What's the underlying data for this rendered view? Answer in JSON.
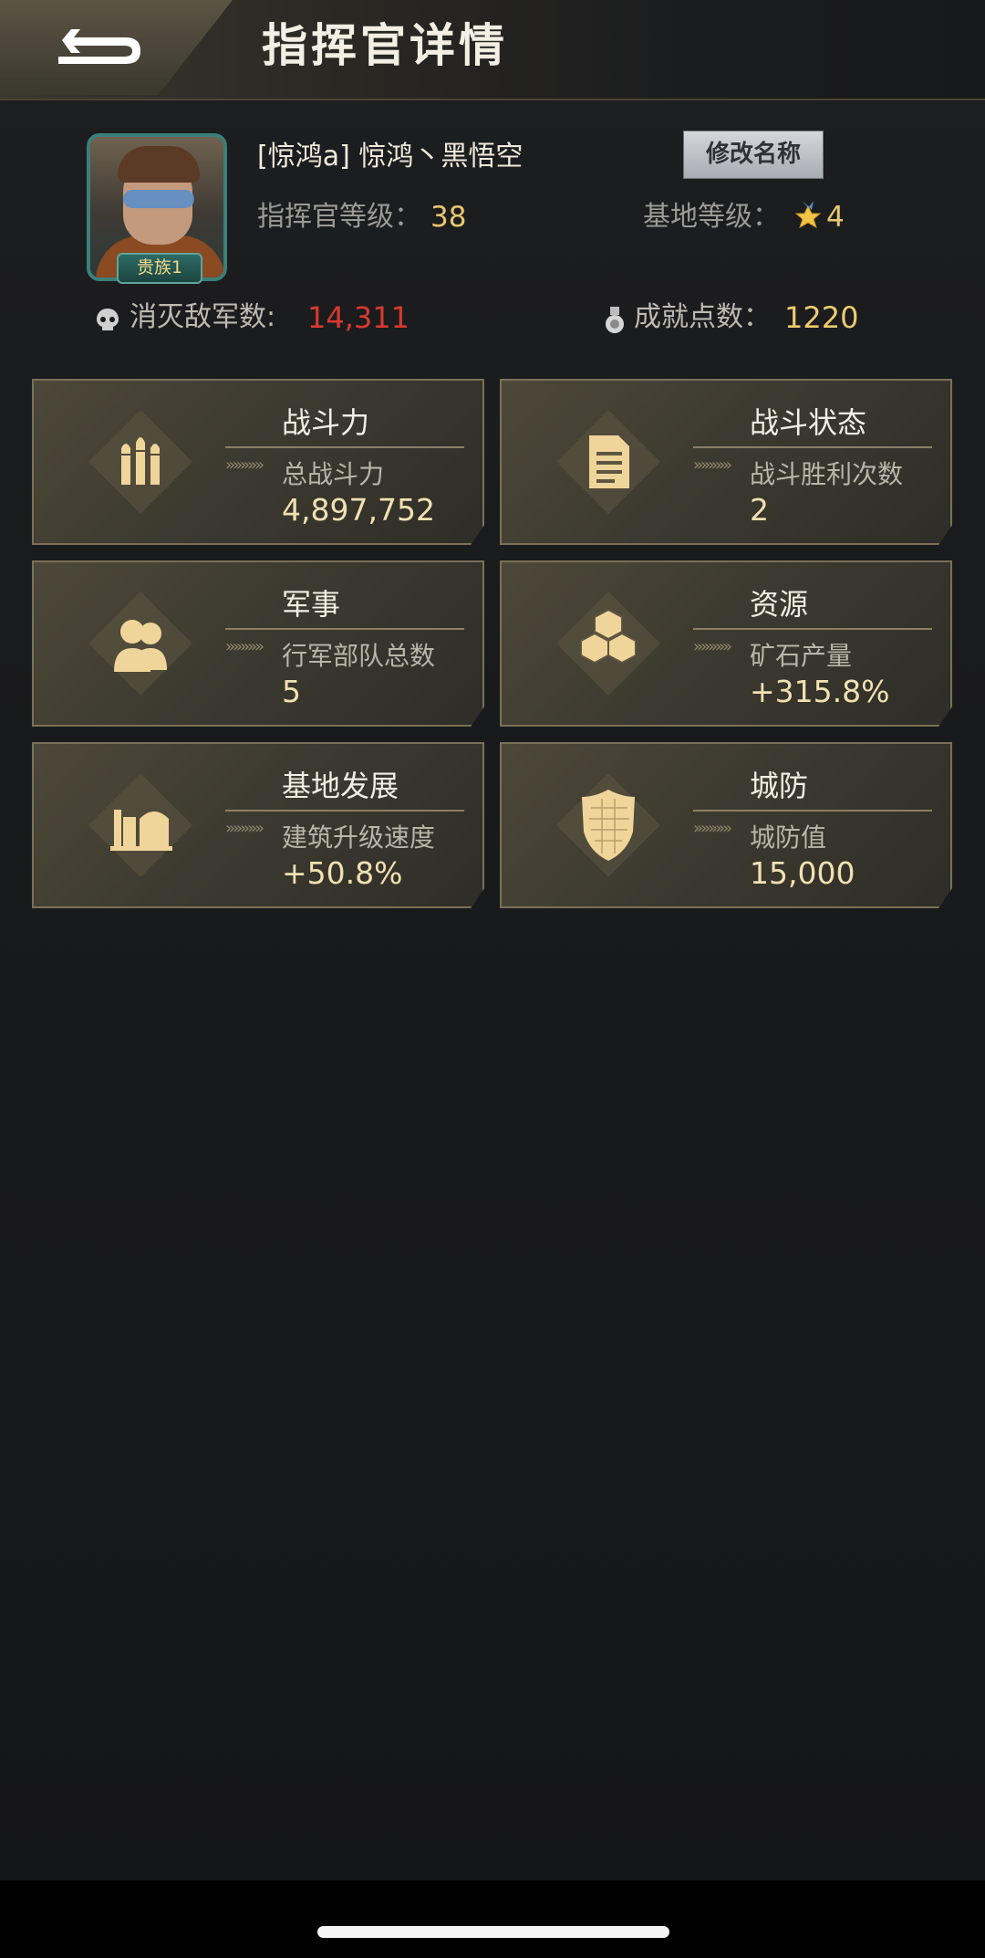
{
  "header": {
    "title": "指挥官详情",
    "back_icon": "back-arrow-icon"
  },
  "profile": {
    "name": "[惊鸿a] 惊鸿丶黑悟空",
    "rank_badge": "贵族1",
    "rename_label": "修改名称",
    "commander_level_label": "指挥官等级：",
    "commander_level": "38",
    "base_level_label": "基地等级：",
    "base_level": "4",
    "kills_label": "消灭敌军数:",
    "kills_value": "14,311",
    "achievement_label": "成就点数：",
    "achievement_value": "1220"
  },
  "cards": [
    {
      "id": "combat",
      "title": "战斗力",
      "subtitle": "总战斗力",
      "value": "4,897,752",
      "icon": "bullets-icon"
    },
    {
      "id": "battle",
      "title": "战斗状态",
      "subtitle": "战斗胜利次数",
      "value": "2",
      "icon": "document-icon"
    },
    {
      "id": "military",
      "title": "军事",
      "subtitle": "行军部队总数",
      "value": "5",
      "icon": "soldiers-icon"
    },
    {
      "id": "resources",
      "title": "资源",
      "subtitle": "矿石产量",
      "value": "+315.8%",
      "icon": "cubes-icon"
    },
    {
      "id": "base",
      "title": "基地发展",
      "subtitle": "建筑升级速度",
      "value": "+50.8%",
      "icon": "buildings-icon"
    },
    {
      "id": "defense",
      "title": "城防",
      "subtitle": "城防值",
      "value": "15,000",
      "icon": "shield-icon"
    }
  ],
  "colors": {
    "accent_gold": "#e9c770",
    "kills_red": "#d8392f",
    "card_border": "#7a7156"
  }
}
